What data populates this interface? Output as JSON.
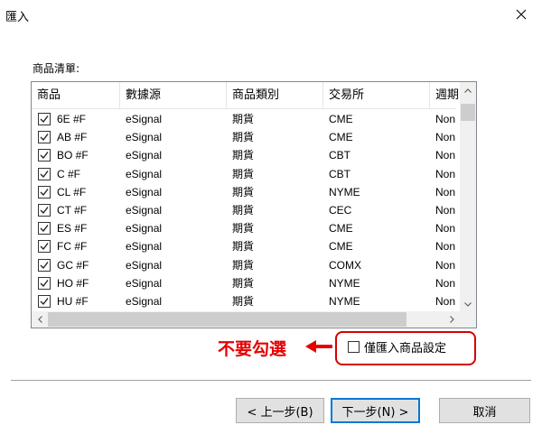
{
  "window": {
    "title": "匯入"
  },
  "list": {
    "label": "商品清單:",
    "columns": [
      "商品",
      "數據源",
      "商品類別",
      "交易所",
      "週期"
    ],
    "rows": [
      {
        "checked": true,
        "symbol": "6E #F",
        "source": "eSignal",
        "category": "期貨",
        "exchange": "CME",
        "period": "Non"
      },
      {
        "checked": true,
        "symbol": "AB #F",
        "source": "eSignal",
        "category": "期貨",
        "exchange": "CME",
        "period": "Non"
      },
      {
        "checked": true,
        "symbol": "BO #F",
        "source": "eSignal",
        "category": "期貨",
        "exchange": "CBT",
        "period": "Non"
      },
      {
        "checked": true,
        "symbol": "C #F",
        "source": "eSignal",
        "category": "期貨",
        "exchange": "CBT",
        "period": "Non"
      },
      {
        "checked": true,
        "symbol": "CL #F",
        "source": "eSignal",
        "category": "期貨",
        "exchange": "NYME",
        "period": "Non"
      },
      {
        "checked": true,
        "symbol": "CT #F",
        "source": "eSignal",
        "category": "期貨",
        "exchange": "CEC",
        "period": "Non"
      },
      {
        "checked": true,
        "symbol": "ES #F",
        "source": "eSignal",
        "category": "期貨",
        "exchange": "CME",
        "period": "Non"
      },
      {
        "checked": true,
        "symbol": "FC #F",
        "source": "eSignal",
        "category": "期貨",
        "exchange": "CME",
        "period": "Non"
      },
      {
        "checked": true,
        "symbol": "GC #F",
        "source": "eSignal",
        "category": "期貨",
        "exchange": "COMX",
        "period": "Non"
      },
      {
        "checked": true,
        "symbol": "HO #F",
        "source": "eSignal",
        "category": "期貨",
        "exchange": "NYME",
        "period": "Non"
      },
      {
        "checked": true,
        "symbol": "HU #F",
        "source": "eSignal",
        "category": "期貨",
        "exchange": "NYME",
        "period": "Non"
      }
    ]
  },
  "annotation": {
    "text": "不要勾選",
    "color": "#e60000"
  },
  "options": {
    "only_import_settings": {
      "label": "僅匯入商品設定",
      "checked": false
    }
  },
  "buttons": {
    "back": "< 上一步(B)",
    "next": "下一步(N) >",
    "cancel": "取消"
  },
  "icons": {
    "close": "close-icon",
    "check": "checkmark-icon",
    "arrow": "arrow-left-icon"
  },
  "colors": {
    "accent": "#0078d7",
    "highlight_border": "#d40000"
  }
}
